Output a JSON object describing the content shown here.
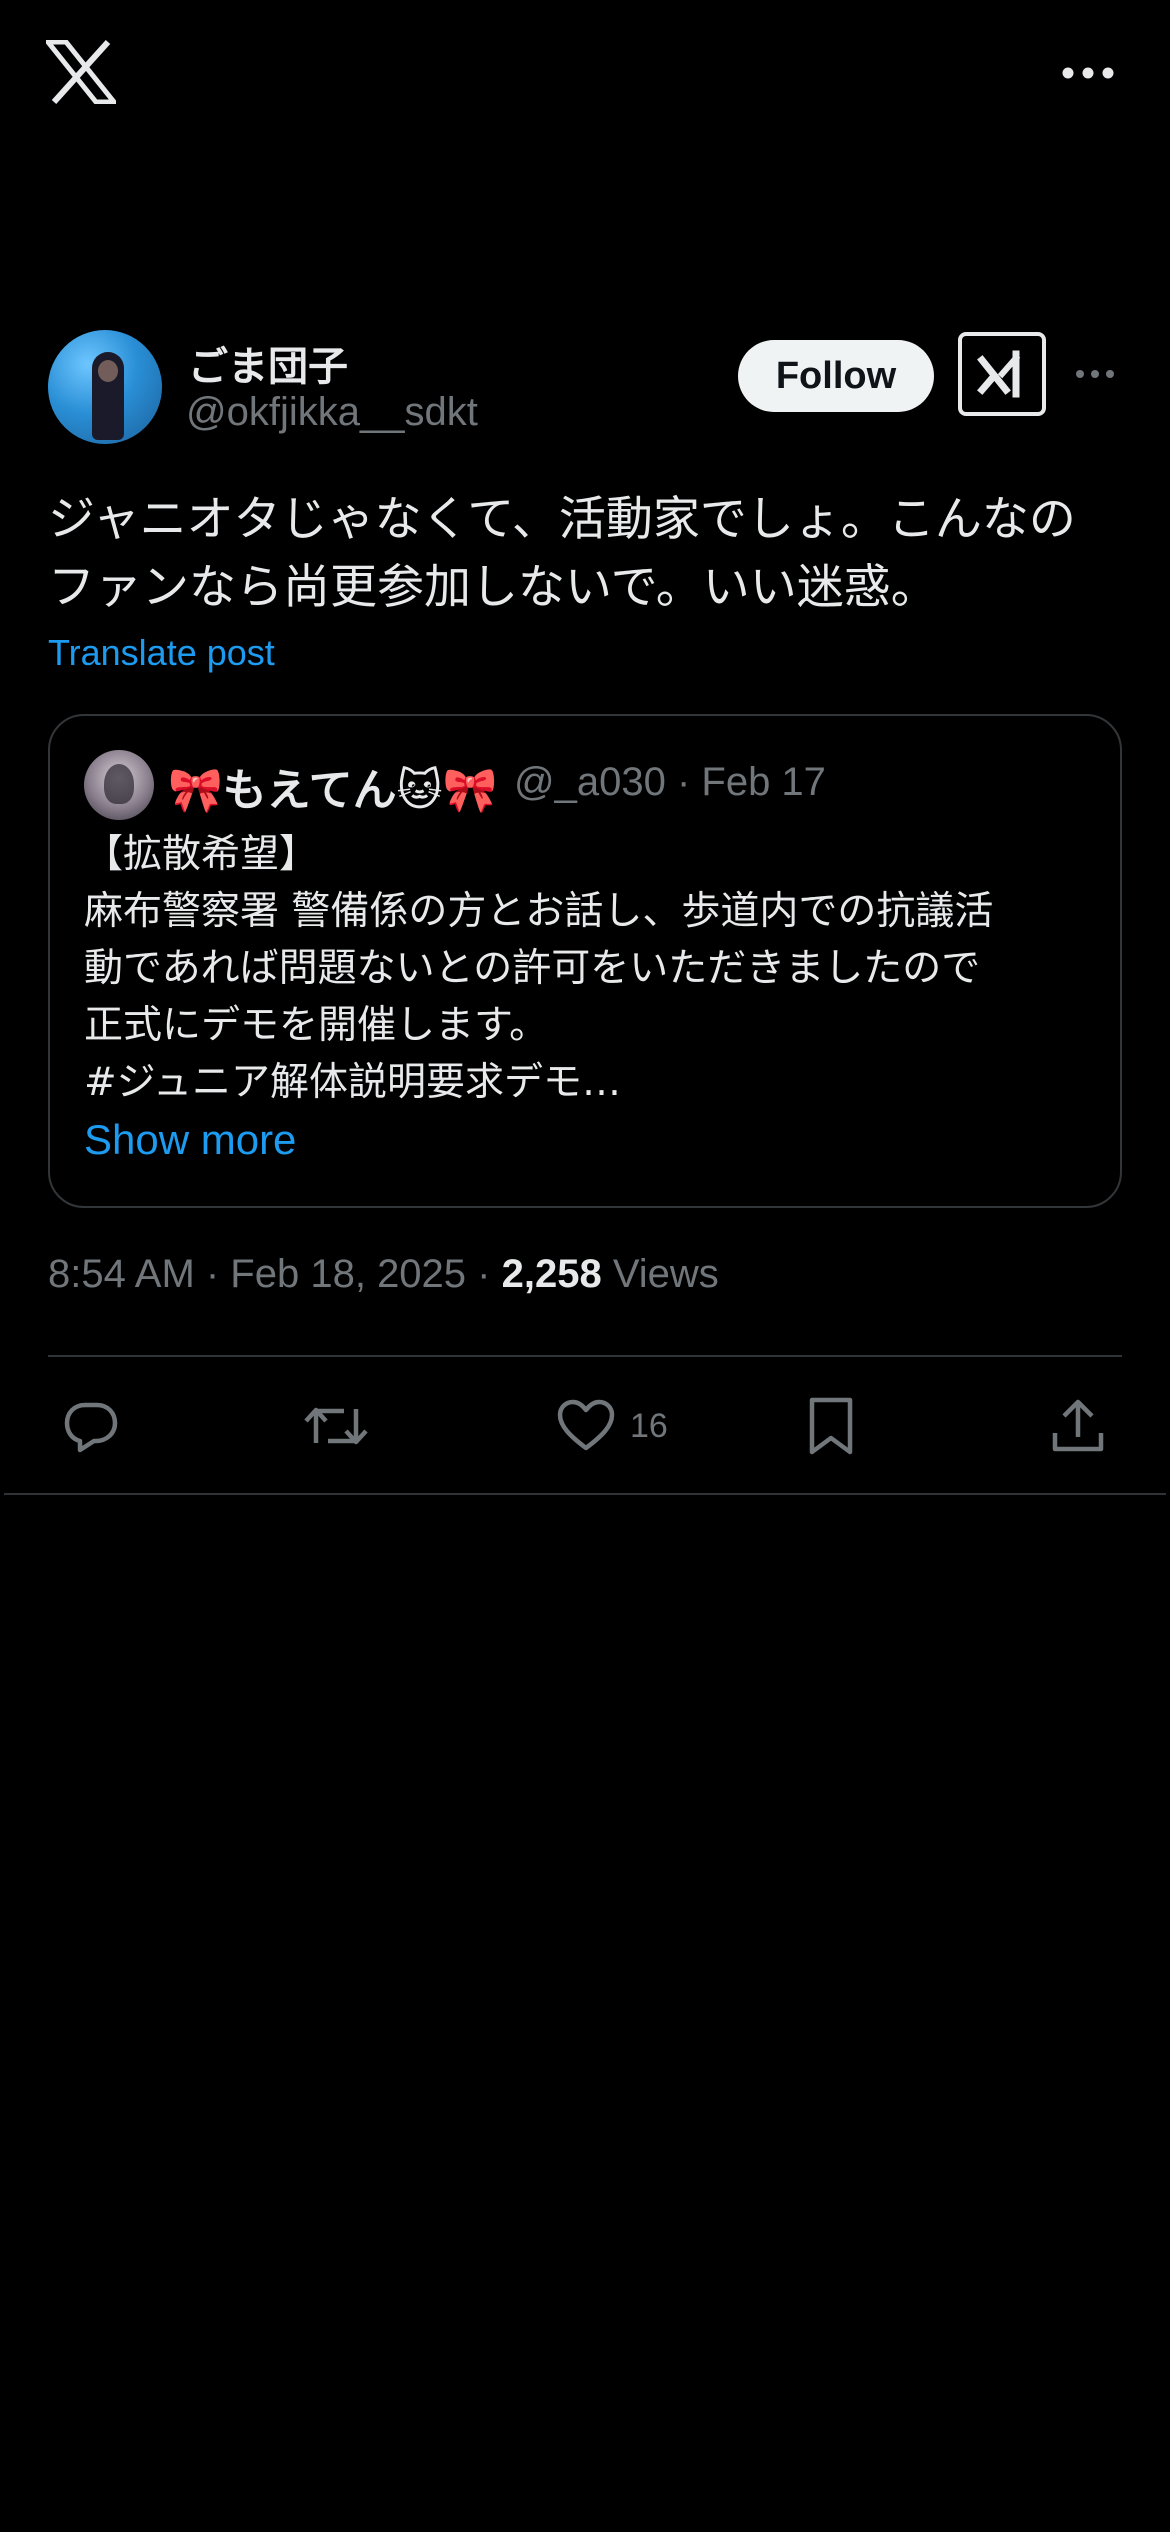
{
  "topbar": {
    "logo_icon": "x-logo-icon",
    "more_icon": "more-horizontal-icon"
  },
  "post": {
    "author": {
      "display_name": "ごま団子",
      "handle": "@okfjikka__sdkt"
    },
    "follow_label": "Follow",
    "grok_icon": "grok-icon",
    "text": "ジャニオタじゃなくて、活動家でしょ。こんなの\nファンなら尚更参加しないで。いい迷惑。",
    "translate_label": "Translate post",
    "quoted": {
      "display_name": "🎀もえてん🐱🎀",
      "handle_and_date": "@_a030 · Feb 17",
      "text": "【拡散希望】\n麻布警察署 警備係の方とお話し、歩道内での抗議活\n動であれば問題ないとの許可をいただきましたので\n正式にデモを開催します。\n#ジュニア解体説明要求デモ…",
      "show_more_label": "Show more"
    },
    "timestamp": "8:54 AM · Feb 18, 2025 · ",
    "views_count": "2,258",
    "views_label": " Views",
    "actions": {
      "reply_icon": "reply-icon",
      "repost_icon": "repost-icon",
      "like_icon": "heart-icon",
      "like_count": "16",
      "bookmark_icon": "bookmark-icon",
      "share_icon": "share-icon"
    }
  },
  "colors": {
    "background": "#000000",
    "text_primary": "#e7e9ea",
    "text_secondary": "#71767b",
    "accent": "#1d9bf0",
    "border": "#2f3336"
  }
}
